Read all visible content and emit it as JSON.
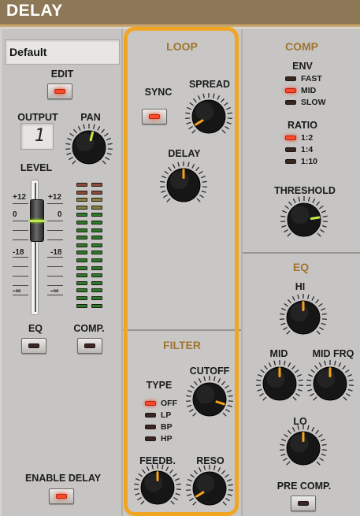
{
  "header": {
    "title": "DELAY"
  },
  "left": {
    "preset_name": "Default",
    "edit_label": "EDIT",
    "output_label": "OUTPUT",
    "output_value": "1",
    "pan_label": "PAN",
    "level_label": "LEVEL",
    "scale": {
      "plus12": "+12",
      "zero": "0",
      "minus18": "-18",
      "minus_inf": "-∞"
    },
    "eq_button_label": "EQ",
    "comp_button_label": "COMP.",
    "enable_delay_label": "ENABLE DELAY"
  },
  "loop": {
    "title": "LOOP",
    "sync_label": "SYNC",
    "spread_label": "SPREAD",
    "delay_label": "DELAY"
  },
  "filter": {
    "title": "FILTER",
    "type_label": "TYPE",
    "type_options": [
      "OFF",
      "LP",
      "BP",
      "HP"
    ],
    "type_selected": "OFF",
    "cutoff_label": "CUTOFF",
    "feedback_label": "FEEDB.",
    "reso_label": "RESO"
  },
  "comp": {
    "title": "COMP",
    "env_label": "ENV",
    "env_options": [
      "FAST",
      "MID",
      "SLOW"
    ],
    "env_selected": "MID",
    "ratio_label": "RATIO",
    "ratio_options": [
      "1:2",
      "1:4",
      "1:10"
    ],
    "ratio_selected": "1:2",
    "threshold_label": "THRESHOLD"
  },
  "eq": {
    "title": "EQ",
    "hi_label": "HI",
    "mid_label": "MID",
    "mid_freq_label": "MID FRQ",
    "lo_label": "LO",
    "pre_comp_label": "PRE COMP."
  },
  "knobs": {
    "pan": {
      "value": 0.55,
      "color": "#c2e84a"
    },
    "spread": {
      "value": 0.05,
      "color": "#f5a21e"
    },
    "delay": {
      "value": 0.5,
      "color": "#f5a21e"
    },
    "cutoff": {
      "value": 0.9,
      "color": "#f5a21e"
    },
    "feedback": {
      "value": 0.5,
      "color": "#f5a21e"
    },
    "reso": {
      "value": 0.05,
      "color": "#f5a21e"
    },
    "threshold": {
      "value": 0.8,
      "color": "#c2e84a"
    },
    "hi": {
      "value": 0.5,
      "color": "#f5a21e"
    },
    "mid": {
      "value": 0.5,
      "color": "#f5a21e"
    },
    "mid_freq": {
      "value": 0.5,
      "color": "#f5a21e"
    },
    "lo": {
      "value": 0.5,
      "color": "#f5a21e"
    }
  },
  "buttons_state": {
    "edit": true,
    "sync": true,
    "eq": false,
    "comp": false,
    "enable_delay": true,
    "pre_comp": false
  },
  "meter": {
    "lit_color": "#2f7a2a",
    "dim_color": "#8c4a3a",
    "yellow_color": "#8a8040"
  },
  "colors": {
    "accent": "#f1a623",
    "header": "#8c7857",
    "section_title": "#a07430"
  }
}
